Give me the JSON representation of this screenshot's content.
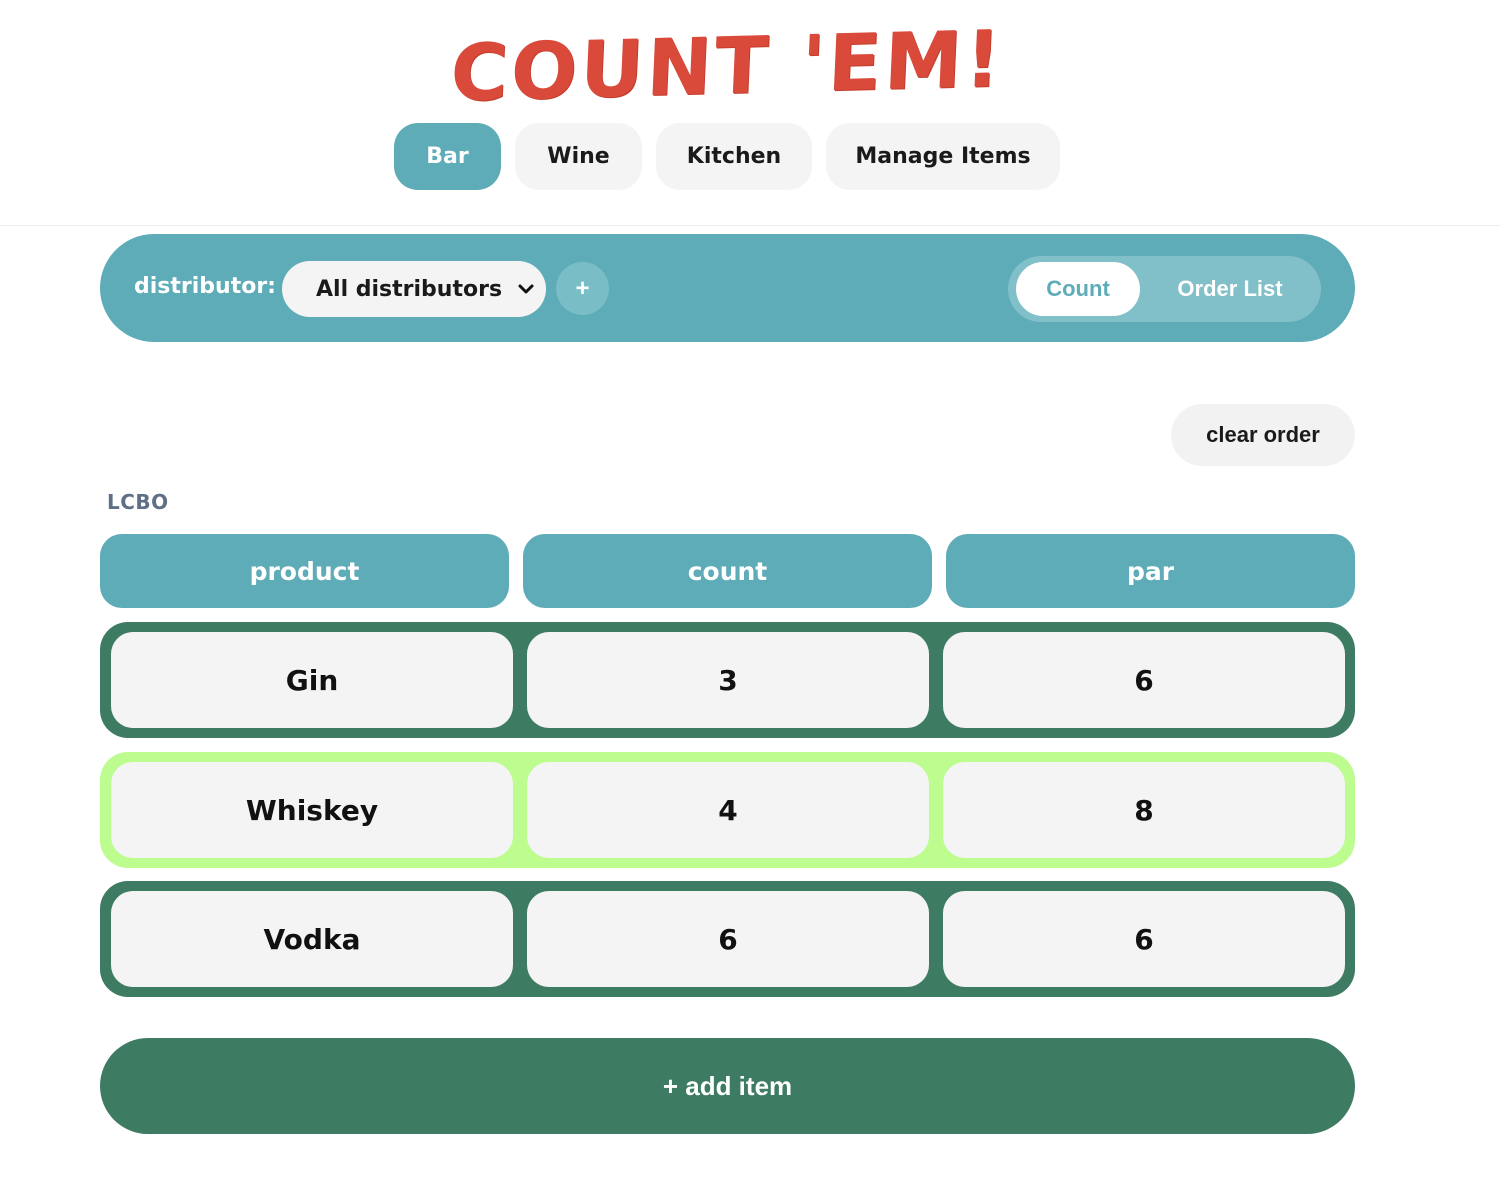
{
  "header": {
    "app_title": "COUNT 'EM!",
    "nav_tabs": [
      {
        "label": "Bar",
        "active": true
      },
      {
        "label": "Wine",
        "active": false
      },
      {
        "label": "Kitchen",
        "active": false
      },
      {
        "label": "Manage Items",
        "active": false
      }
    ]
  },
  "toolbar": {
    "distributor_label": "distributor:",
    "distributor_selected": "All distributors",
    "add_distributor_label": "+",
    "mode_count_label": "Count",
    "mode_order_list_label": "Order List",
    "active_mode": "Count"
  },
  "actions": {
    "clear_order_label": "clear order",
    "add_item_label": "+ add item"
  },
  "inventory": {
    "group_label": "LCBO",
    "columns": [
      "product",
      "count",
      "par"
    ],
    "rows": [
      {
        "product": "Gin",
        "count": "3",
        "par": "6"
      },
      {
        "product": "Whiskey",
        "count": "4",
        "par": "8"
      },
      {
        "product": "Vodka",
        "count": "6",
        "par": "6"
      }
    ]
  },
  "colors": {
    "brand_red": "#d94a3a",
    "teal": "#5eacb8",
    "row_green": "#3d7b62",
    "row_highlight": "#bdfc8f"
  },
  "icons": {
    "select_chevron": "chevron-down-icon"
  }
}
